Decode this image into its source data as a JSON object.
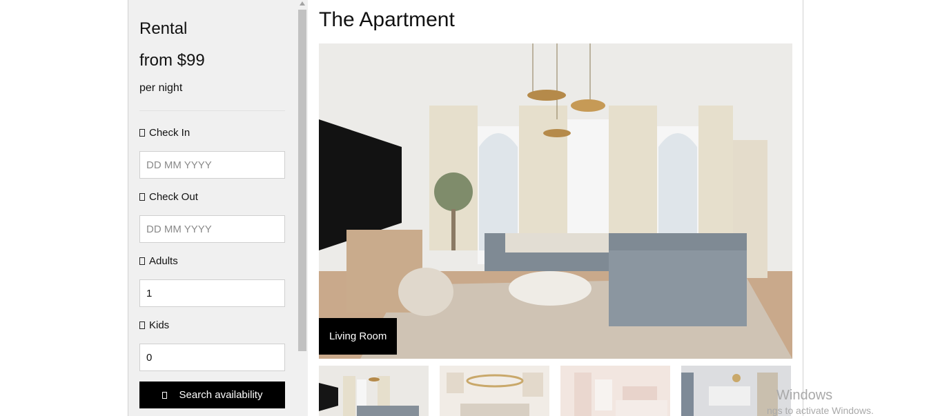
{
  "sidebar": {
    "title": "Rental",
    "price": "from $99",
    "per_night": "per night",
    "check_in": {
      "label": "Check In",
      "placeholder": "DD MM YYYY",
      "icon": "calendar-icon"
    },
    "check_out": {
      "label": "Check Out",
      "placeholder": "DD MM YYYY",
      "icon": "calendar-icon"
    },
    "adults": {
      "label": "Adults",
      "value": "1",
      "icon": "user-icon"
    },
    "kids": {
      "label": "Kids",
      "value": "0",
      "icon": "child-icon"
    },
    "search_button": {
      "label": "Search availability",
      "icon": "search-icon"
    }
  },
  "main": {
    "title": "The Apartment",
    "hero_caption": "Living Room",
    "thumbnails": [
      "living-room",
      "dining-room",
      "bedroom",
      "lounge"
    ]
  },
  "os_watermark": {
    "line1": "Windows",
    "line2": "ngs to activate Windows."
  },
  "colors": {
    "sidebar_bg": "#f0f0f0",
    "button_bg": "#000000",
    "caption_bg": "#000000"
  }
}
